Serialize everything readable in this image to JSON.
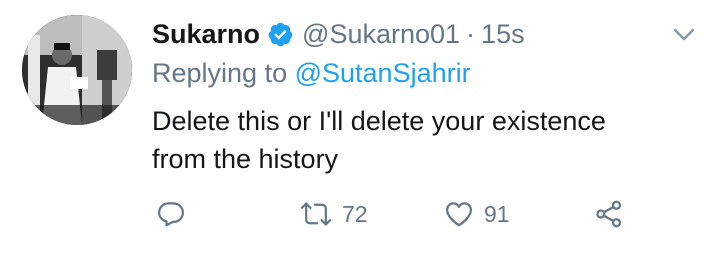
{
  "tweet": {
    "author": {
      "name": "Sukarno",
      "handle": "@Sukarno01",
      "verified": true
    },
    "separator": "·",
    "timestamp": "15s",
    "reply": {
      "prefix": "Replying to",
      "mention": "@SutanSjahrir"
    },
    "text_line1": "Delete this or I'll delete your existence",
    "text_line2": "from the history",
    "actions": {
      "reply_icon": "reply-icon",
      "retweet_icon": "retweet-icon",
      "retweet_count": "72",
      "like_icon": "heart-icon",
      "like_count": "91",
      "share_icon": "share-icon"
    }
  },
  "colors": {
    "text": "#14171a",
    "secondary": "#657786",
    "accent": "#1da1f2"
  }
}
